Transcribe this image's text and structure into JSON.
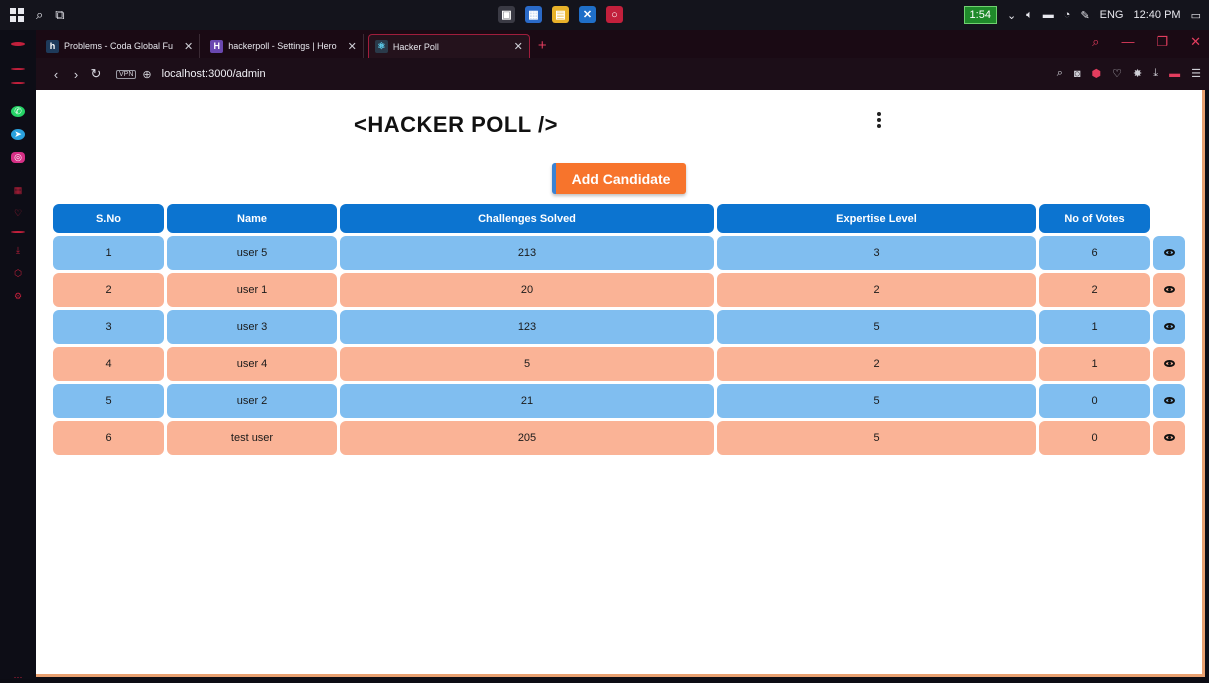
{
  "taskbar": {
    "battery": "1:54",
    "language": "ENG",
    "time": "12:40 PM"
  },
  "tabs": [
    {
      "label": "Problems - Coda Global Fu",
      "favicon": "h"
    },
    {
      "label": "hackerpoll - Settings | Hero",
      "favicon": "H"
    },
    {
      "label": "Hacker Poll",
      "favicon": "react"
    }
  ],
  "address": {
    "url": "localhost:3000/admin",
    "vpn": "VPN"
  },
  "page": {
    "title": "<HACKER POLL />",
    "add_button": "Add Candidate",
    "columns": [
      "S.No",
      "Name",
      "Challenges Solved",
      "Expertise Level",
      "No of Votes"
    ],
    "rows": [
      {
        "sno": "1",
        "name": "user 5",
        "challenges": "213",
        "level": "3",
        "votes": "6"
      },
      {
        "sno": "2",
        "name": "user 1",
        "challenges": "20",
        "level": "2",
        "votes": "2"
      },
      {
        "sno": "3",
        "name": "user 3",
        "challenges": "123",
        "level": "5",
        "votes": "1"
      },
      {
        "sno": "4",
        "name": "user 4",
        "challenges": "5",
        "level": "2",
        "votes": "1"
      },
      {
        "sno": "5",
        "name": "user 2",
        "challenges": "21",
        "level": "5",
        "votes": "0"
      },
      {
        "sno": "6",
        "name": "test user",
        "challenges": "205",
        "level": "5",
        "votes": "0"
      }
    ]
  },
  "colors": {
    "header": "#0c74d0",
    "row_blue": "#80bef0",
    "row_peach": "#fab396",
    "button": "#f7742c"
  }
}
